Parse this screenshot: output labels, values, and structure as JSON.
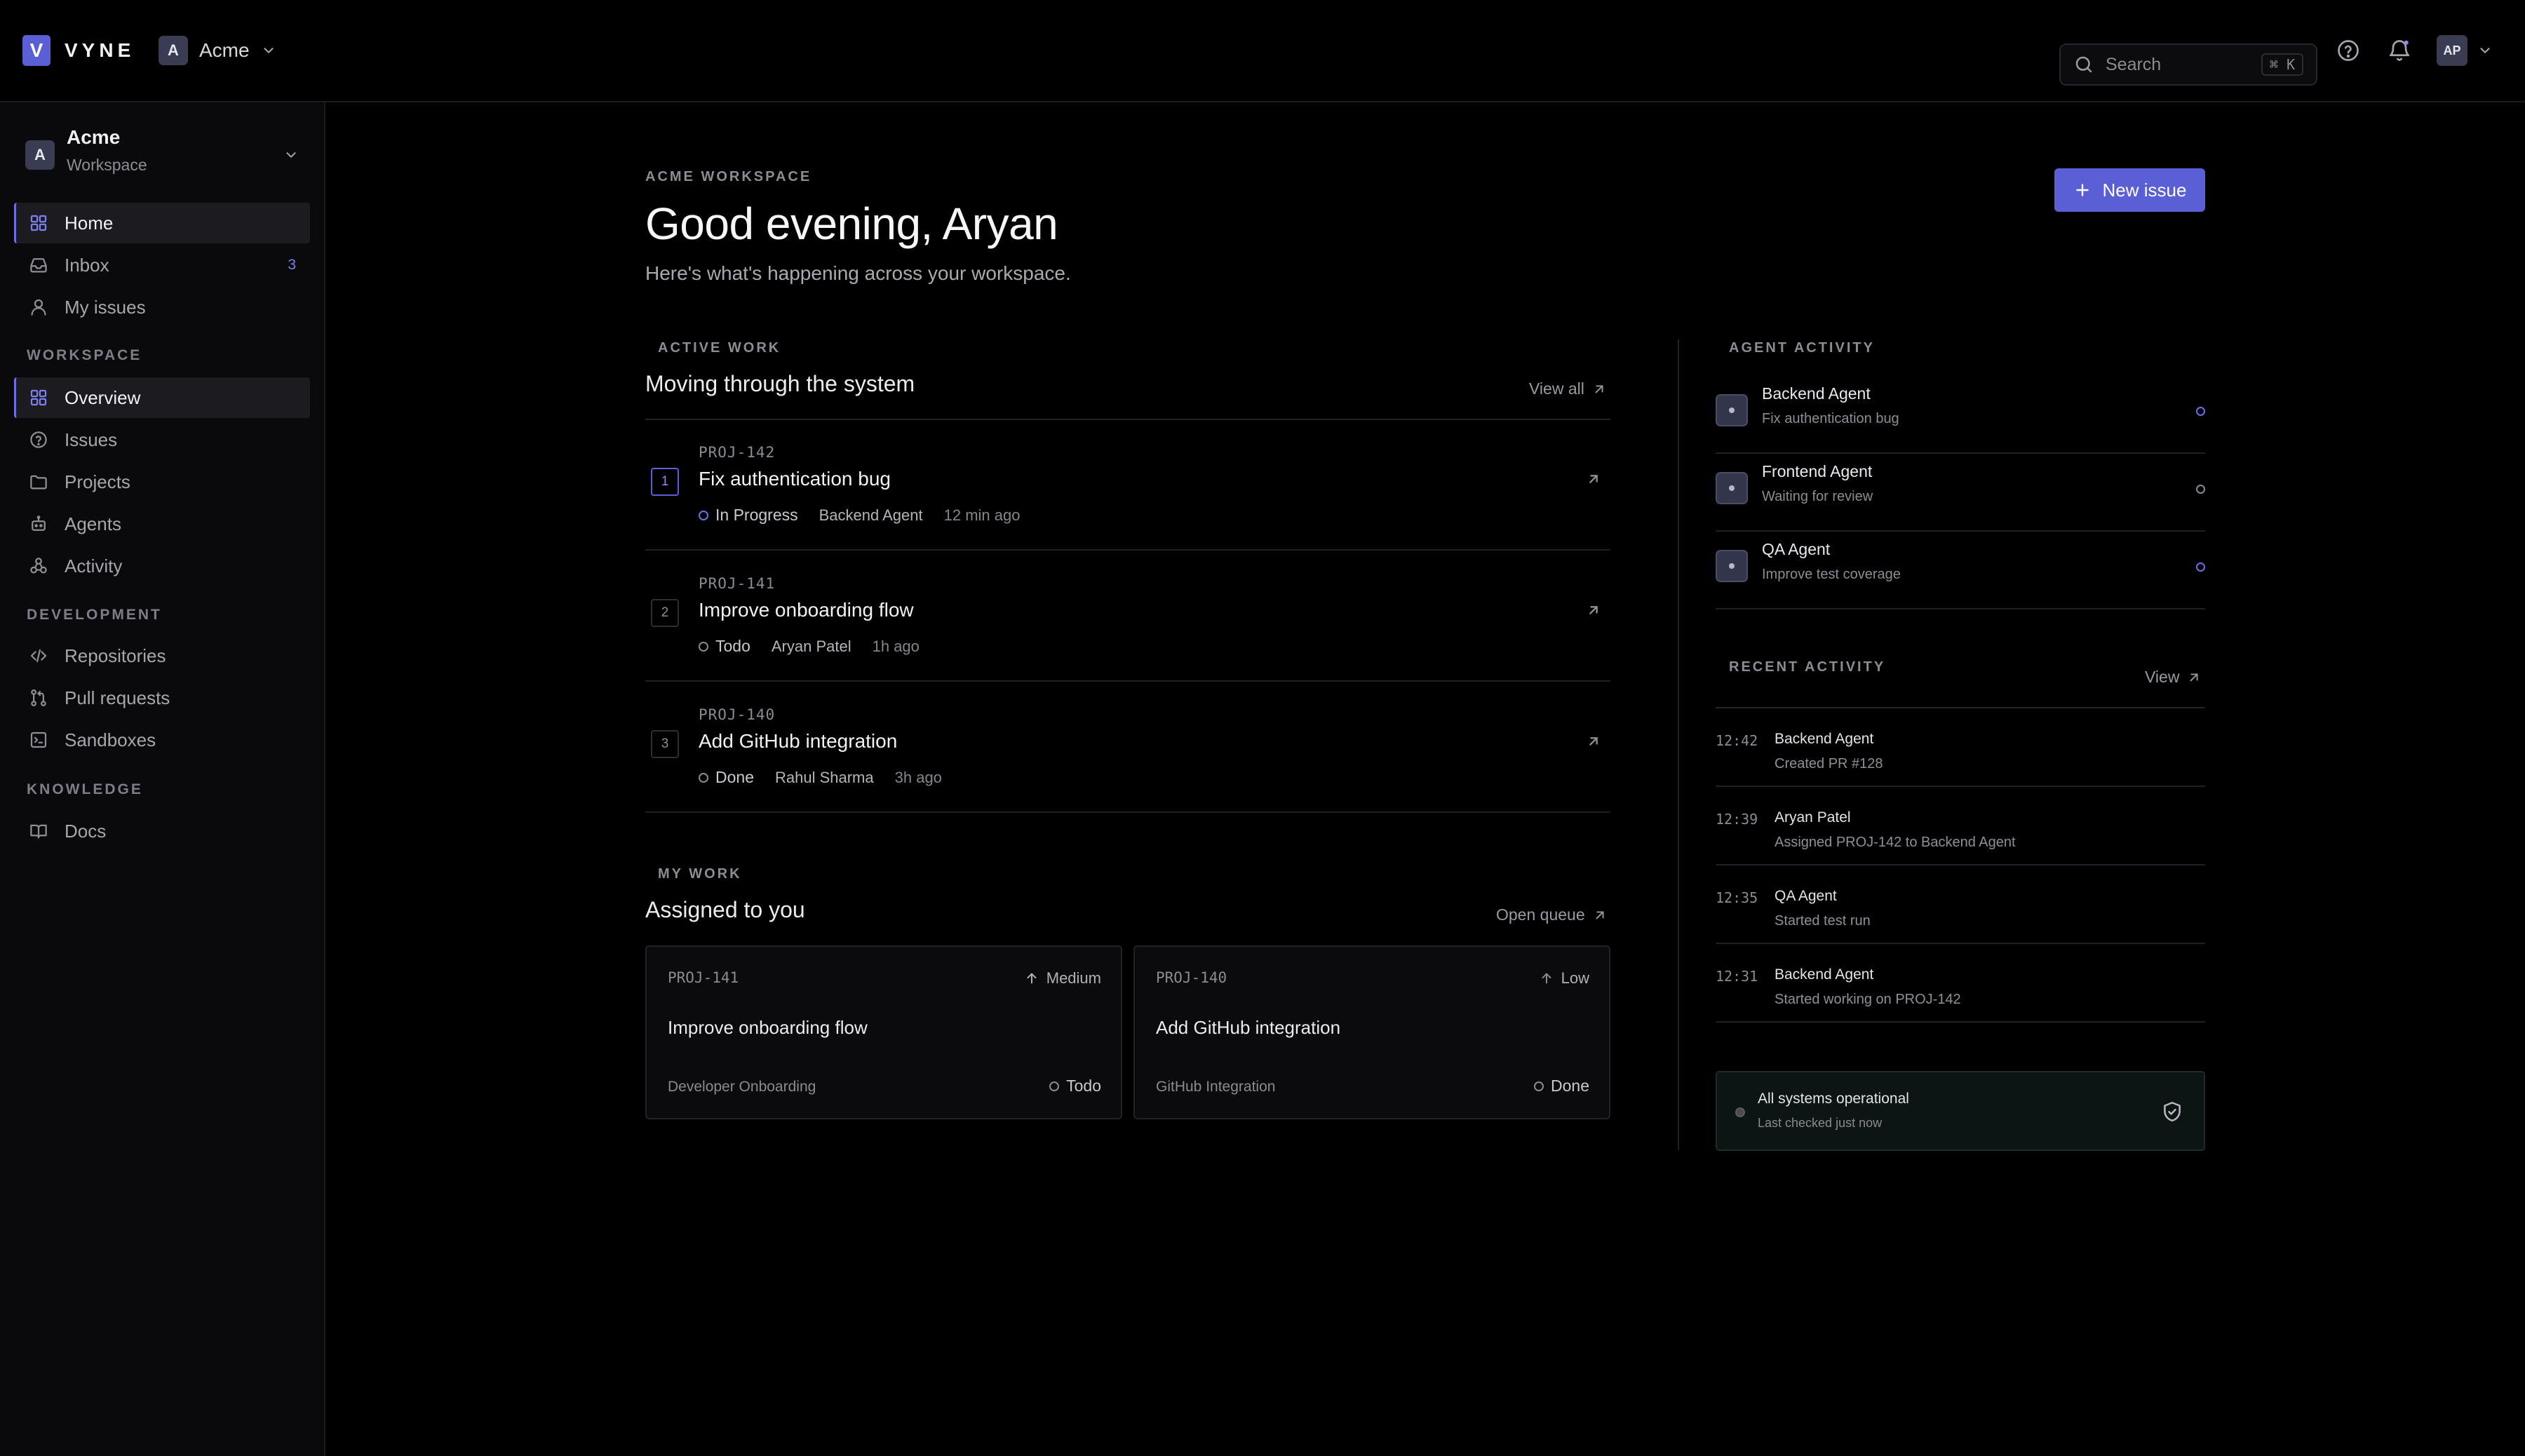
{
  "app": {
    "logo_letter": "V",
    "name": "VYNE"
  },
  "topbar": {
    "workspace_initial": "A",
    "workspace_name": "Acme",
    "search_placeholder": "Search",
    "search_shortcut": "⌘ K",
    "user_initials": "AP"
  },
  "sidebar": {
    "workspace": {
      "initial": "A",
      "name": "Acme",
      "sub": "Workspace"
    },
    "primary": [
      {
        "label": "Home",
        "icon": "grid-icon",
        "active": true
      },
      {
        "label": "Inbox",
        "icon": "inbox-icon",
        "badge": "3"
      },
      {
        "label": "My issues",
        "icon": "user-icon"
      }
    ],
    "sections": [
      {
        "title": "WORKSPACE",
        "items": [
          {
            "label": "Overview",
            "icon": "grid-icon",
            "active": true
          },
          {
            "label": "Issues",
            "icon": "help-circle-icon"
          },
          {
            "label": "Projects",
            "icon": "folder-icon"
          },
          {
            "label": "Agents",
            "icon": "bot-icon"
          },
          {
            "label": "Activity",
            "icon": "activity-icon"
          }
        ]
      },
      {
        "title": "DEVELOPMENT",
        "items": [
          {
            "label": "Repositories",
            "icon": "code-icon"
          },
          {
            "label": "Pull requests",
            "icon": "git-pull-request-icon"
          },
          {
            "label": "Sandboxes",
            "icon": "terminal-icon"
          }
        ]
      },
      {
        "title": "KNOWLEDGE",
        "items": [
          {
            "label": "Docs",
            "icon": "book-icon"
          }
        ]
      }
    ]
  },
  "greeting": {
    "eyebrow": "ACME WORKSPACE",
    "title": "Good evening, Aryan",
    "subtitle": "Here's what's happening across your workspace.",
    "new_issue_label": "New issue"
  },
  "active_work": {
    "eyebrow": "ACTIVE WORK",
    "title": "Moving through the system",
    "view_all": "View all",
    "items": [
      {
        "num": "1",
        "id": "PROJ-142",
        "title": "Fix authentication bug",
        "status": "In Progress",
        "assignee": "Backend Agent",
        "time": "12 min ago"
      },
      {
        "num": "2",
        "id": "PROJ-141",
        "title": "Improve onboarding flow",
        "status": "Todo",
        "assignee": "Aryan Patel",
        "time": "1h ago"
      },
      {
        "num": "3",
        "id": "PROJ-140",
        "title": "Add GitHub integration",
        "status": "Done",
        "assignee": "Rahul Sharma",
        "time": "3h ago"
      }
    ]
  },
  "my_work": {
    "eyebrow": "MY WORK",
    "title": "Assigned to you",
    "open_queue": "Open queue",
    "cards": [
      {
        "id": "PROJ-141",
        "priority": "Medium",
        "title": "Improve onboarding flow",
        "project": "Developer Onboarding",
        "status": "Todo"
      },
      {
        "id": "PROJ-140",
        "priority": "Low",
        "title": "Add GitHub integration",
        "project": "GitHub Integration",
        "status": "Done"
      }
    ]
  },
  "agent_activity": {
    "eyebrow": "AGENT ACTIVITY",
    "agents": [
      {
        "name": "Backend Agent",
        "status": "Fix authentication bug",
        "state": "active"
      },
      {
        "name": "Frontend Agent",
        "status": "Waiting for review",
        "state": "idle"
      },
      {
        "name": "QA Agent",
        "status": "Improve test coverage",
        "state": "active"
      }
    ]
  },
  "recent_activity": {
    "eyebrow": "RECENT ACTIVITY",
    "view": "View",
    "items": [
      {
        "time": "12:42",
        "who": "Backend Agent",
        "what": "Created PR #128"
      },
      {
        "time": "12:39",
        "who": "Aryan Patel",
        "what": "Assigned PROJ-142 to Backend Agent"
      },
      {
        "time": "12:35",
        "who": "QA Agent",
        "what": "Started test run"
      },
      {
        "time": "12:31",
        "who": "Backend Agent",
        "what": "Started working on PROJ-142"
      }
    ]
  },
  "system_status": {
    "title": "All systems operational",
    "sub": "Last checked just now"
  },
  "colors": {
    "accent": "#5b5fd6",
    "background": "#000000",
    "sidebar": "#0a0a0c"
  }
}
